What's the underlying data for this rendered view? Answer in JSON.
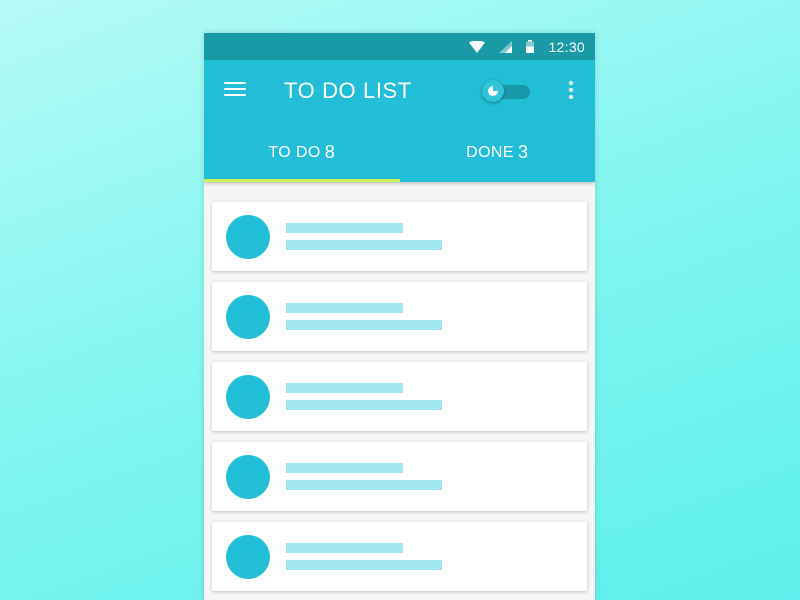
{
  "status_bar": {
    "time": "12:30"
  },
  "app_bar": {
    "title": "TO DO LIST",
    "toggle_state": "off"
  },
  "tabs": [
    {
      "label": "TO DO",
      "count": "8",
      "active": true
    },
    {
      "label": "DONE",
      "count": "3",
      "active": false
    }
  ],
  "todo_items": [
    {
      "placeholder": true
    },
    {
      "placeholder": true
    },
    {
      "placeholder": true
    },
    {
      "placeholder": true
    },
    {
      "placeholder": true
    }
  ],
  "colors": {
    "primary": "#22bdd6",
    "primary_dark": "#1a9aa7",
    "tab_indicator": "#c9f35a",
    "placeholder_line": "#a3e7ef",
    "background_start": "#b5fbf6",
    "background_end": "#5ef0ea"
  },
  "icons": {
    "menu": "menu-icon",
    "more": "more-vert-icon",
    "wifi": "wifi-icon",
    "signal": "signal-icon",
    "battery": "battery-icon"
  }
}
